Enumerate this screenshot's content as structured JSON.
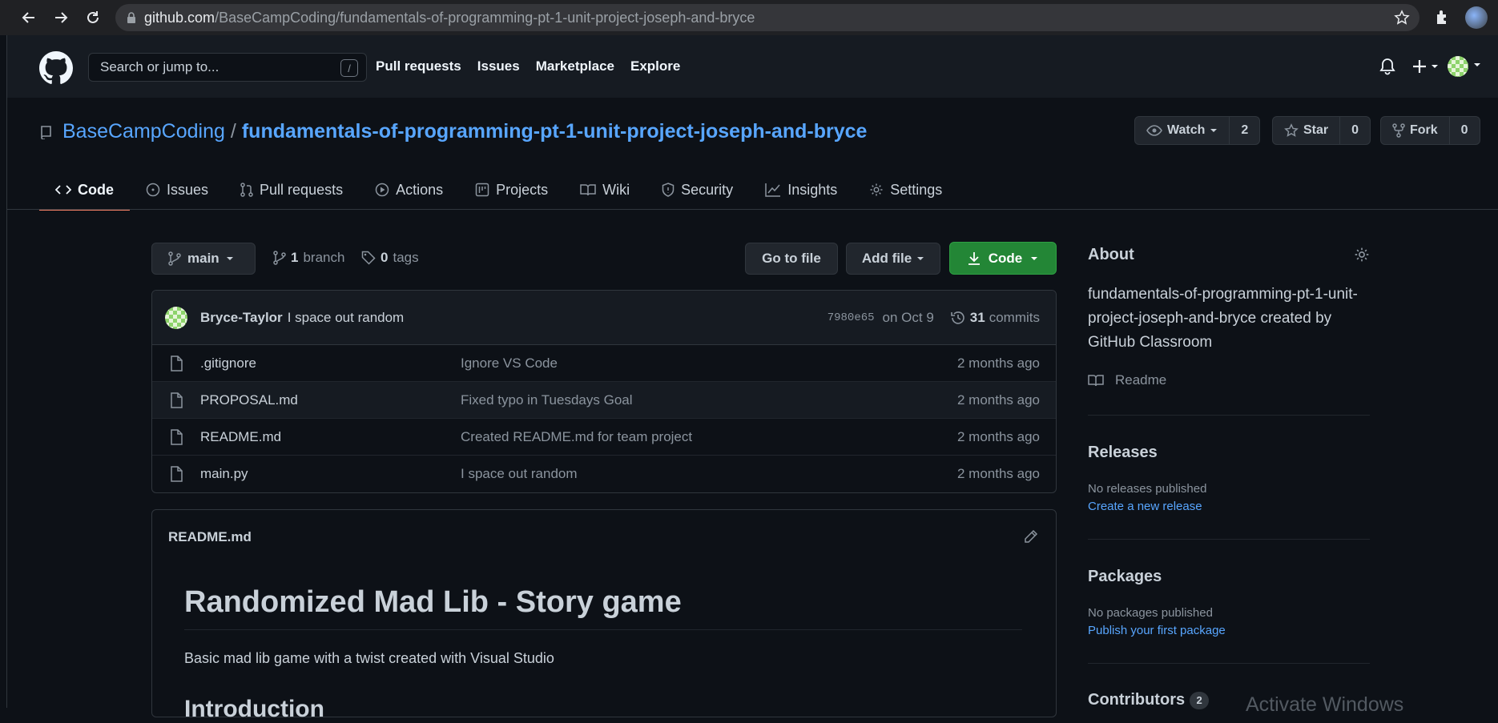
{
  "browser": {
    "url_host": "github.com",
    "url_path": "/BaseCampCoding/fundamentals-of-programming-pt-1-unit-project-joseph-and-bryce"
  },
  "header": {
    "search_placeholder": "Search or jump to...",
    "search_shortcut": "/",
    "nav": [
      "Pull requests",
      "Issues",
      "Marketplace",
      "Explore"
    ]
  },
  "repo": {
    "owner": "BaseCampCoding",
    "separator": "/",
    "name": "fundamentals-of-programming-pt-1-unit-project-joseph-and-bryce",
    "watch_label": "Watch",
    "watch_count": "2",
    "star_label": "Star",
    "star_count": "0",
    "fork_label": "Fork",
    "fork_count": "0"
  },
  "tabs": [
    "Code",
    "Issues",
    "Pull requests",
    "Actions",
    "Projects",
    "Wiki",
    "Security",
    "Insights",
    "Settings"
  ],
  "toolbar": {
    "branch": "main",
    "branch_count": "1",
    "branch_word": "branch",
    "tag_count": "0",
    "tag_word": "tags",
    "go_to_file": "Go to file",
    "add_file": "Add file",
    "code": "Code"
  },
  "commit": {
    "author": "Bryce-Taylor",
    "message": "I space out random",
    "sha": "7980e65",
    "date": "on Oct 9",
    "count": "31",
    "count_word": "commits"
  },
  "files": [
    {
      "name": ".gitignore",
      "message": "Ignore VS Code",
      "age": "2 months ago"
    },
    {
      "name": "PROPOSAL.md",
      "message": "Fixed typo in Tuesdays Goal",
      "age": "2 months ago"
    },
    {
      "name": "README.md",
      "message": "Created README.md for team project",
      "age": "2 months ago"
    },
    {
      "name": "main.py",
      "message": "I space out random",
      "age": "2 months ago"
    }
  ],
  "readme": {
    "filename": "README.md",
    "title": "Randomized Mad Lib - Story game",
    "body": "Basic mad lib game with a twist created with Visual Studio",
    "h2": "Introduction"
  },
  "sidebar": {
    "about_title": "About",
    "about_desc": "fundamentals-of-programming-pt-1-unit-project-joseph-and-bryce created by GitHub Classroom",
    "readme_label": "Readme",
    "releases_title": "Releases",
    "releases_none": "No releases published",
    "releases_link": "Create a new release",
    "packages_title": "Packages",
    "packages_none": "No packages published",
    "packages_link": "Publish your first package",
    "contributors_title": "Contributors",
    "contributors_count": "2"
  },
  "overlay": {
    "watermark": "Activate Windows"
  },
  "colors": {
    "background": "#0d1117",
    "header": "#161b22",
    "link": "#58a6ff",
    "code_button": "#238636",
    "active_tab": "#f78166"
  }
}
